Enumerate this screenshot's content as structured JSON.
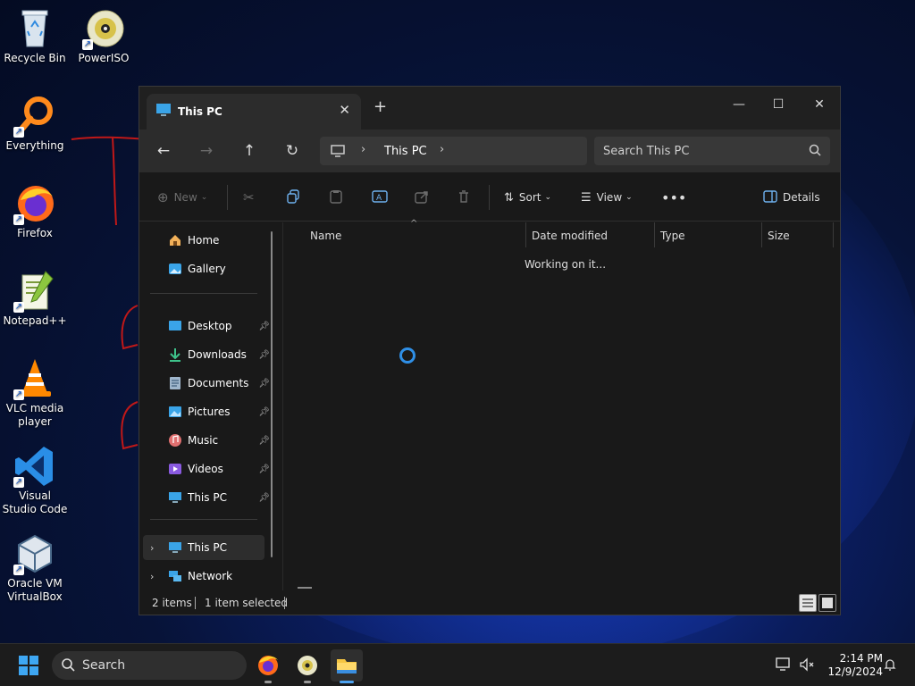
{
  "desktop": {
    "icons": [
      {
        "label": "Recycle Bin"
      },
      {
        "label": "PowerISO"
      },
      {
        "label": "Everything"
      },
      {
        "label": "Firefox"
      },
      {
        "label": "Notepad++"
      },
      {
        "label": "VLC media player"
      },
      {
        "label": "Visual Studio Code"
      },
      {
        "label": "Oracle VM VirtualBox"
      }
    ]
  },
  "explorer": {
    "tab_title": "This PC",
    "address": {
      "segment": "This PC"
    },
    "search": {
      "placeholder": "Search This PC"
    },
    "toolbar": {
      "new_label": "New",
      "sort_label": "Sort",
      "view_label": "View",
      "details_label": "Details"
    },
    "nav": {
      "home": "Home",
      "gallery": "Gallery",
      "quick_access": [
        {
          "label": "Desktop"
        },
        {
          "label": "Downloads"
        },
        {
          "label": "Documents"
        },
        {
          "label": "Pictures"
        },
        {
          "label": "Music"
        },
        {
          "label": "Videos"
        },
        {
          "label": "This PC"
        }
      ],
      "tree": [
        {
          "label": "This PC",
          "selected": true
        },
        {
          "label": "Network",
          "selected": false
        }
      ]
    },
    "columns": [
      "Name",
      "Date modified",
      "Type",
      "Size"
    ],
    "content_status": "Working on it...",
    "status": {
      "items": "2 items",
      "selected": "1 item selected"
    }
  },
  "taskbar": {
    "search_label": "Search",
    "time": "2:14 PM",
    "date": "12/9/2024"
  },
  "colors": {
    "accent": "#2f8fe6",
    "window_bg": "#191919",
    "chrome_bg": "#202020"
  }
}
